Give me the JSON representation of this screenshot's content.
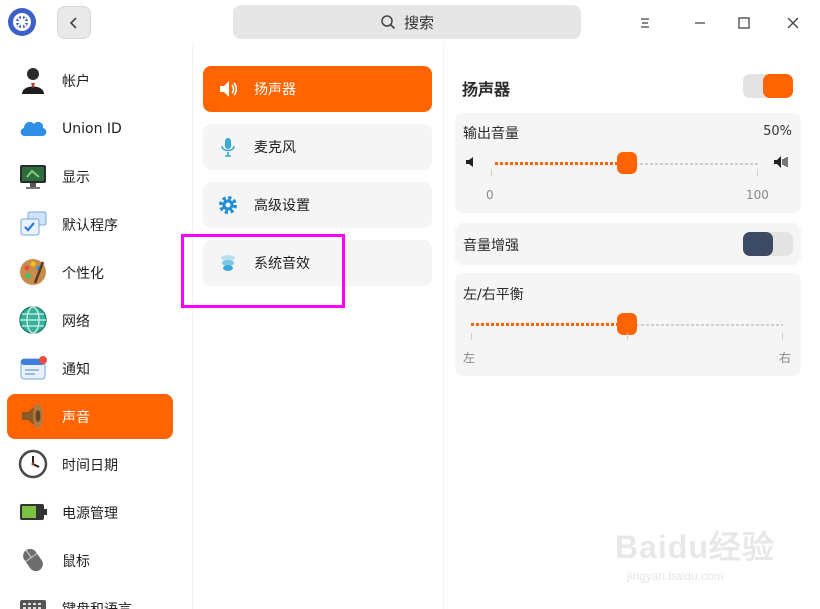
{
  "window": {
    "search_placeholder": "搜索",
    "icons": {
      "logo": "settings-gear-logo-icon",
      "back": "chevron-left-icon",
      "search": "search-icon",
      "menu": "menu-icon",
      "minimize": "minimize-icon",
      "maximize": "maximize-icon",
      "close": "close-icon"
    }
  },
  "nav": {
    "items": [
      {
        "label": "帐户",
        "icon": "user-icon"
      },
      {
        "label": "Union ID",
        "icon": "cloud-icon"
      },
      {
        "label": "显示",
        "icon": "monitor-icon"
      },
      {
        "label": "默认程序",
        "icon": "default-apps-icon"
      },
      {
        "label": "个性化",
        "icon": "palette-icon"
      },
      {
        "label": "网络",
        "icon": "network-globe-icon"
      },
      {
        "label": "通知",
        "icon": "notification-icon"
      },
      {
        "label": "声音",
        "icon": "speaker-icon",
        "active": true
      },
      {
        "label": "时间日期",
        "icon": "clock-icon"
      },
      {
        "label": "电源管理",
        "icon": "battery-icon"
      },
      {
        "label": "鼠标",
        "icon": "mouse-icon"
      },
      {
        "label": "键盘和语言",
        "icon": "keyboard-icon"
      }
    ]
  },
  "sound_menu": {
    "items": [
      {
        "label": "扬声器",
        "icon": "speaker-icon",
        "active": true
      },
      {
        "label": "麦克风",
        "icon": "microphone-icon"
      },
      {
        "label": "高级设置",
        "icon": "gear-icon"
      },
      {
        "label": "系统音效",
        "icon": "sound-effects-icon"
      }
    ]
  },
  "speaker": {
    "title": "扬声器",
    "enabled": true,
    "output_volume": {
      "label": "输出音量",
      "value_text": "50%",
      "value": 50,
      "min_label": "0",
      "max_label": "100"
    },
    "volume_boost": {
      "label": "音量增强",
      "enabled": false
    },
    "balance": {
      "label": "左/右平衡",
      "value": 50,
      "left_label": "左",
      "right_label": "右"
    }
  },
  "colors": {
    "accent": "#ff6400",
    "toggle_off_knob": "#3c4a63",
    "panel_bg": "#f5f5f5",
    "highlight": "#ff00ff"
  },
  "watermark": {
    "brand": "Baidu经验",
    "url": "jingyan.baidu.com"
  }
}
